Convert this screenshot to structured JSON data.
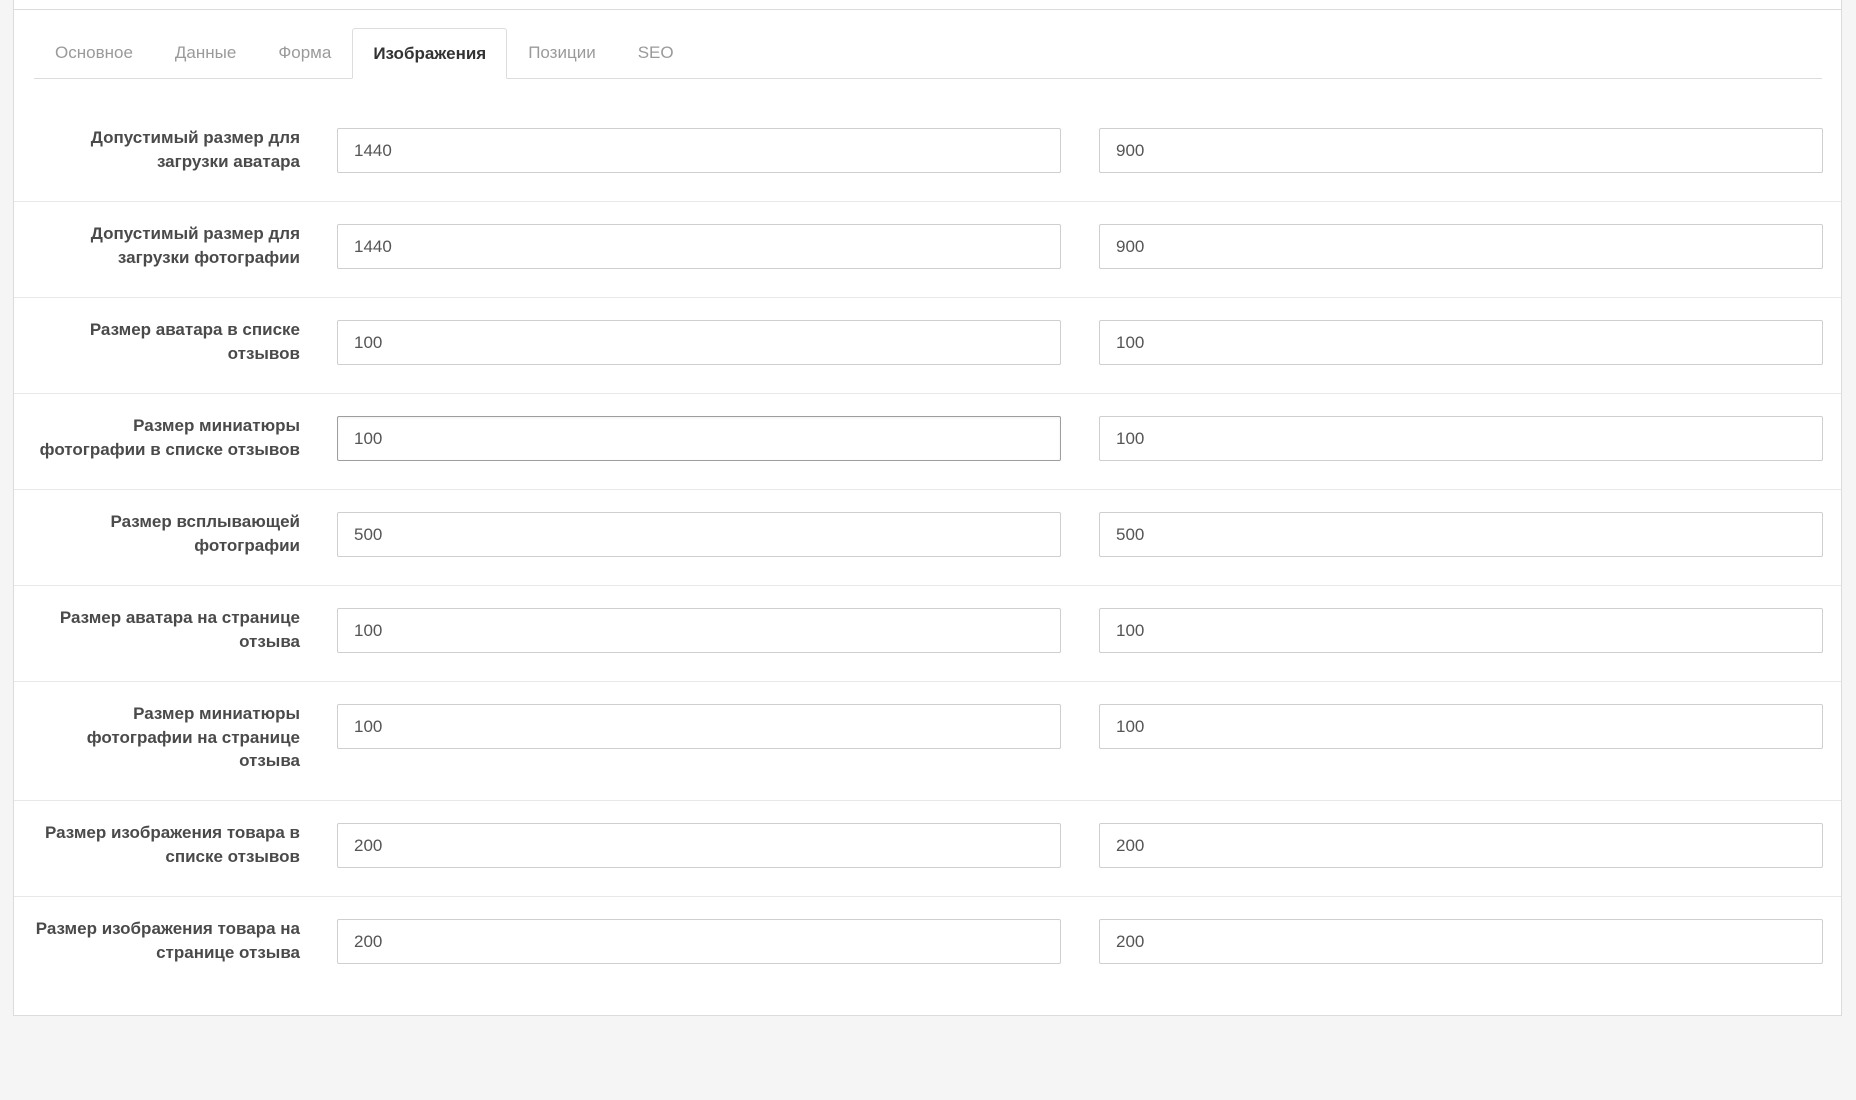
{
  "tabs": [
    {
      "label": "Основное",
      "active": false
    },
    {
      "label": "Данные",
      "active": false
    },
    {
      "label": "Форма",
      "active": false
    },
    {
      "label": "Изображения",
      "active": true
    },
    {
      "label": "Позиции",
      "active": false
    },
    {
      "label": "SEO",
      "active": false
    }
  ],
  "settings": [
    {
      "label": "Допустимый размер для загрузки аватара",
      "width": "1440",
      "height": "900"
    },
    {
      "label": "Допустимый размер для загрузки фотографии",
      "width": "1440",
      "height": "900"
    },
    {
      "label": "Размер аватара в списке отзывов",
      "width": "100",
      "height": "100"
    },
    {
      "label": "Размер миниатюры фотографии в списке отзывов",
      "width": "100",
      "height": "100"
    },
    {
      "label": "Размер всплывающей фотографии",
      "width": "500",
      "height": "500"
    },
    {
      "label": "Размер аватара на странице отзыва",
      "width": "100",
      "height": "100"
    },
    {
      "label": "Размер миниатюры фотографии на странице отзыва",
      "width": "100",
      "height": "100"
    },
    {
      "label": "Размер изображения товара в списке отзывов",
      "width": "200",
      "height": "200"
    },
    {
      "label": "Размер изображения товара на странице отзыва",
      "width": "200",
      "height": "200"
    }
  ]
}
